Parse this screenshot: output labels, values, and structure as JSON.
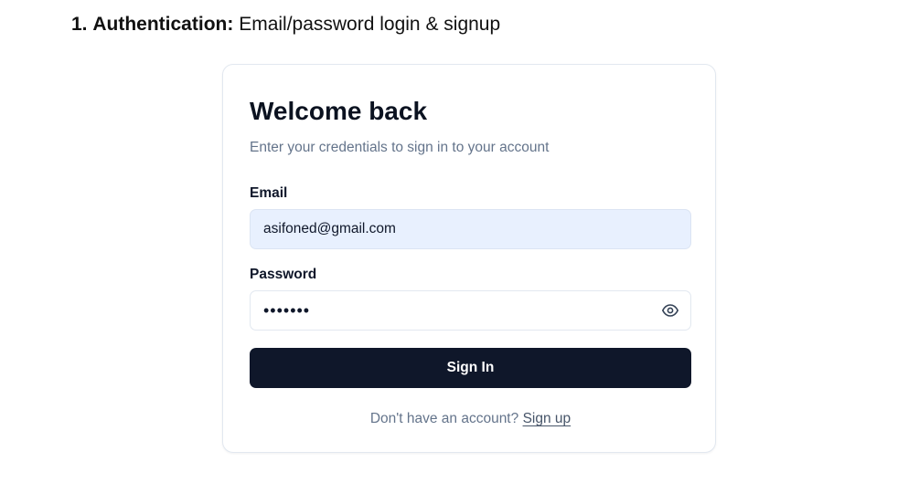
{
  "heading": {
    "number": "1.",
    "title": "Authentication:",
    "description": "Email/password login & signup"
  },
  "card": {
    "title": "Welcome back",
    "subtitle": "Enter your credentials to sign in to your account",
    "email": {
      "label": "Email",
      "value": "asifoned@gmail.com"
    },
    "password": {
      "label": "Password",
      "value": "•••••••",
      "toggle_icon": "eye-icon"
    },
    "submit_label": "Sign In",
    "footer": {
      "prompt": "Don't have an account?",
      "link": "Sign up"
    }
  },
  "colors": {
    "primary_button": "#0f172a",
    "autofill_background": "#e8f0fe",
    "muted_text": "#64748b"
  }
}
